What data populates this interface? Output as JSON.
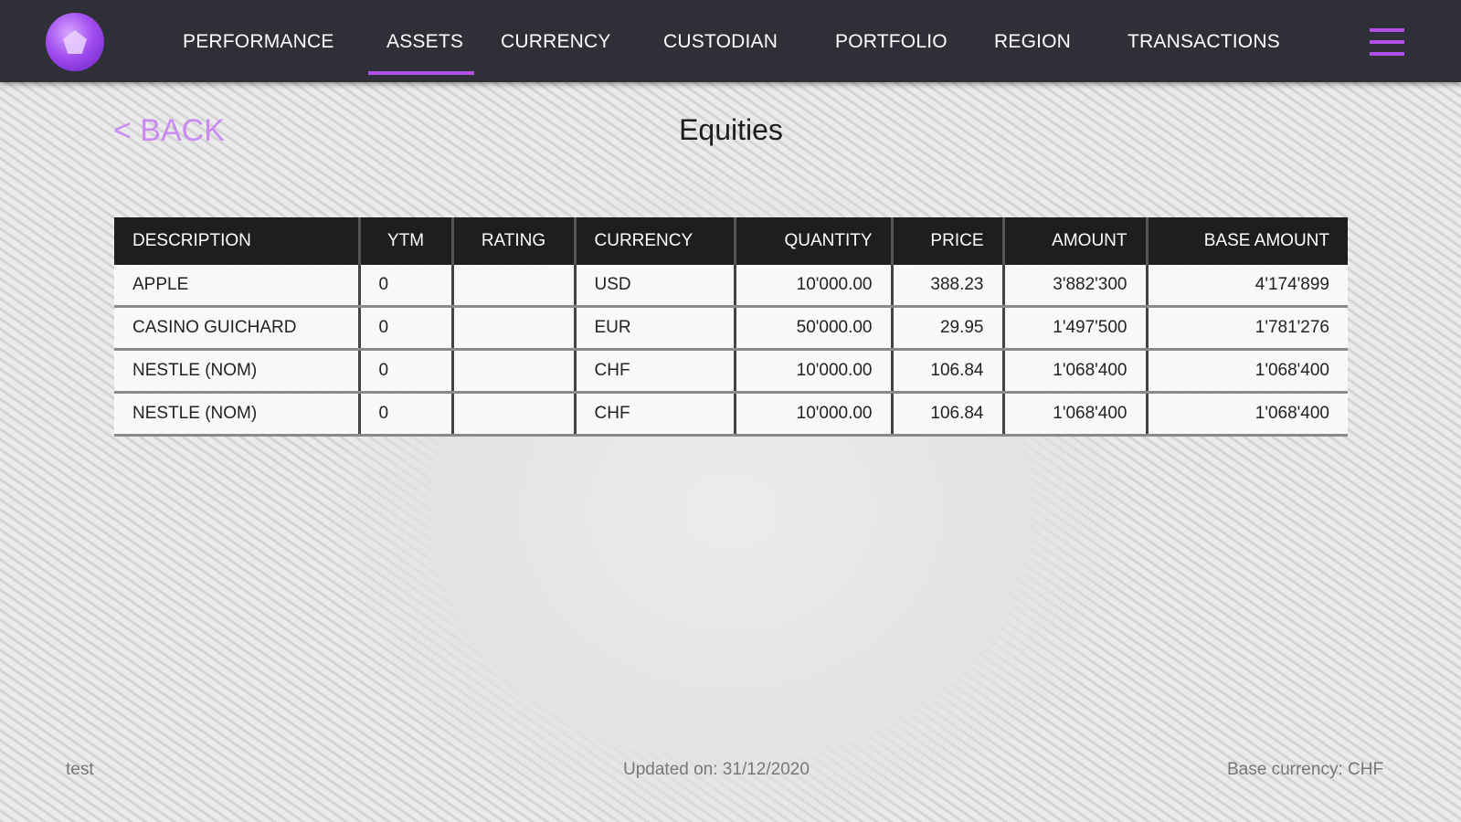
{
  "nav": {
    "items": [
      "PERFORMANCE",
      "ASSETS",
      "CURRENCY",
      "CUSTODIAN",
      "PORTFOLIO",
      "REGION",
      "TRANSACTIONS"
    ],
    "active": "ASSETS",
    "accent_color": "#b34ee8"
  },
  "back_label": "< BACK",
  "title": "Equities",
  "table": {
    "headers": [
      "DESCRIPTION",
      "YTM",
      "RATING",
      "CURRENCY",
      "QUANTITY",
      "PRICE",
      "AMOUNT",
      "BASE AMOUNT"
    ],
    "rows": [
      [
        "APPLE",
        "0",
        "",
        "USD",
        "10'000.00",
        "388.23",
        "3'882'300",
        "4'174'899"
      ],
      [
        "CASINO GUICHARD",
        "0",
        "",
        "EUR",
        "50'000.00",
        "29.95",
        "1'497'500",
        "1'781'276"
      ],
      [
        "NESTLE (NOM)",
        "0",
        "",
        "CHF",
        "10'000.00",
        "106.84",
        "1'068'400",
        "1'068'400"
      ],
      [
        "NESTLE (NOM)",
        "0",
        "",
        "CHF",
        "10'000.00",
        "106.84",
        "1'068'400",
        "1'068'400"
      ]
    ]
  },
  "footer": {
    "left": "test",
    "center": "Updated on: 31/12/2020",
    "right": "Base currency: CHF"
  }
}
